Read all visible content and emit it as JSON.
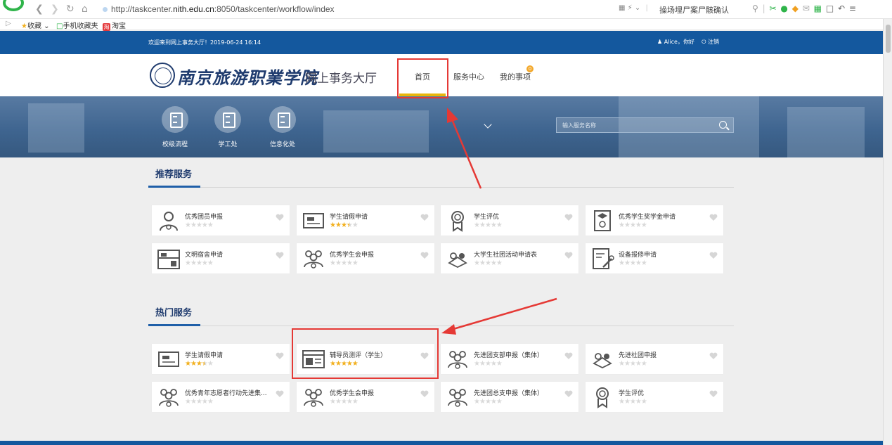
{
  "browser": {
    "url_prefix": "http://taskcenter.",
    "url_domain": "nith.edu.cn",
    "url_suffix": ":8050/taskcenter/workflow/index",
    "news_text": "操场埋尸案尸骸确认",
    "bookmarks": [
      "收藏",
      "手机收藏夹",
      "淘宝"
    ]
  },
  "topbar": {
    "welcome": "欢迎来到网上事务大厅！2019-06-24 16:14",
    "user_greeting": "Alice，你好",
    "logout": "注销"
  },
  "header": {
    "school_name": "南京旅游职業学院",
    "hall_name": "网上事务大厅",
    "nav": {
      "home": "首页",
      "service_center": "服务中心",
      "my_items": "我的事项",
      "my_items_badge": "0"
    }
  },
  "banner": {
    "quick_links": [
      "校级流程",
      "学工处",
      "信息化处"
    ],
    "search_placeholder": "输入服务名称"
  },
  "recommended": {
    "title": "推荐服务",
    "items": [
      {
        "name": "优秀团员申报",
        "rating": 0,
        "icon": "person-icon"
      },
      {
        "name": "学生请假申请",
        "rating": 3.5,
        "icon": "leave-form-icon"
      },
      {
        "name": "学生评优",
        "rating": 0,
        "icon": "medal-icon"
      },
      {
        "name": "优秀学生奖学金申请",
        "rating": 0,
        "icon": "scholarship-icon"
      },
      {
        "name": "文明宿舍申请",
        "rating": 0,
        "icon": "dormitory-icon"
      },
      {
        "name": "优秀学生会申报",
        "rating": 0,
        "icon": "group-icon"
      },
      {
        "name": "大学生社团活动申请表",
        "rating": 0,
        "icon": "club-icon"
      },
      {
        "name": "设备报修申请",
        "rating": 0,
        "icon": "repair-icon"
      }
    ]
  },
  "hot": {
    "title": "热门服务",
    "items": [
      {
        "name": "学生请假申请",
        "rating": 3.5,
        "icon": "leave-form-icon"
      },
      {
        "name": "辅导员测评（学生）",
        "rating": 5,
        "icon": "evaluation-icon"
      },
      {
        "name": "先进团支部申报（集体）",
        "rating": 0,
        "icon": "group-icon"
      },
      {
        "name": "先进社团申报",
        "rating": 0,
        "icon": "club-icon"
      },
      {
        "name": "优秀青年志愿者行动先进集...",
        "rating": 0,
        "icon": "group-icon"
      },
      {
        "name": "优秀学生会申报",
        "rating": 0,
        "icon": "group-icon"
      },
      {
        "name": "先进团总支申报（集体）",
        "rating": 0,
        "icon": "group-icon"
      },
      {
        "name": "学生评优",
        "rating": 0,
        "icon": "medal-icon"
      }
    ]
  },
  "colors": {
    "primary": "#14589e",
    "accent_gold": "#e8b60c",
    "highlight_red": "#e53935",
    "star": "#f2b01e"
  }
}
